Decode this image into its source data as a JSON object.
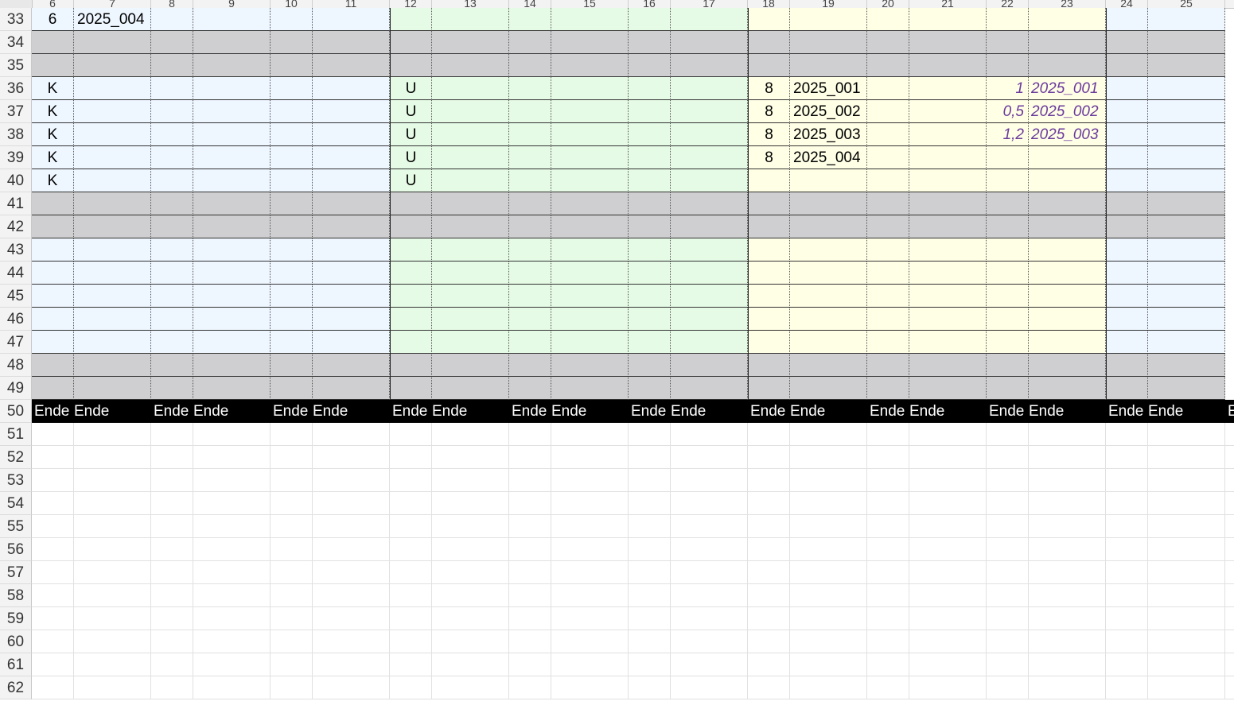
{
  "column_headers": [
    "6",
    "7",
    "8",
    "9",
    "10",
    "11",
    "12",
    "13",
    "14",
    "15",
    "16",
    "17",
    "18",
    "19",
    "20",
    "21",
    "22",
    "23",
    "24",
    "25"
  ],
  "colors": {
    "blue_band": "#eef6ff",
    "green_band": "#e6fbe6",
    "yellow_band": "#ffffe6",
    "gray_row": "#cfcfd1",
    "end_row": "#000000",
    "italic_values": "#6a3a9c"
  },
  "rows": [
    {
      "num": "33",
      "type": "data",
      "cells": {
        "0": "6",
        "1": "2025_004"
      }
    },
    {
      "num": "34",
      "type": "gray",
      "cells": {}
    },
    {
      "num": "35",
      "type": "gray",
      "cells": {}
    },
    {
      "num": "36",
      "type": "data",
      "cells": {
        "0": "K",
        "6": "U",
        "12": "8",
        "13": "2025_001",
        "16": "1",
        "17": "2025_001"
      }
    },
    {
      "num": "37",
      "type": "data",
      "cells": {
        "0": "K",
        "6": "U",
        "12": "8",
        "13": "2025_002",
        "16": "0,5",
        "17": "2025_002"
      }
    },
    {
      "num": "38",
      "type": "data",
      "cells": {
        "0": "K",
        "6": "U",
        "12": "8",
        "13": "2025_003",
        "16": "1,2",
        "17": "2025_003"
      }
    },
    {
      "num": "39",
      "type": "data",
      "cells": {
        "0": "K",
        "6": "U",
        "12": "8",
        "13": "2025_004"
      }
    },
    {
      "num": "40",
      "type": "data",
      "cells": {
        "0": "K",
        "6": "U"
      }
    },
    {
      "num": "41",
      "type": "gray",
      "cells": {}
    },
    {
      "num": "42",
      "type": "gray",
      "cells": {}
    },
    {
      "num": "43",
      "type": "data",
      "cells": {}
    },
    {
      "num": "44",
      "type": "data",
      "cells": {}
    },
    {
      "num": "45",
      "type": "data",
      "cells": {}
    },
    {
      "num": "46",
      "type": "data",
      "cells": {}
    },
    {
      "num": "47",
      "type": "data",
      "cells": {}
    },
    {
      "num": "48",
      "type": "gray",
      "cells": {}
    },
    {
      "num": "49",
      "type": "gray",
      "cells": {}
    },
    {
      "num": "50",
      "type": "end",
      "cells": {
        "0": "Ende",
        "1": "Ende",
        "3": "Ende",
        "4": "Ende",
        "6": "Ende",
        "7": "Ende",
        "9": "Ende",
        "10": "Ende",
        "12": "Ende",
        "13": "Ende",
        "15": "Ende",
        "16": "Ende",
        "18": "Ende",
        "19": "Ende",
        "21": "Ende",
        "22": "Ende",
        "24": "Ende",
        "25": "Ende",
        "27": "Ende",
        "28": "Ende",
        "30": "E"
      }
    },
    {
      "num": "51",
      "type": "empty",
      "cells": {}
    },
    {
      "num": "52",
      "type": "empty",
      "cells": {}
    },
    {
      "num": "53",
      "type": "empty",
      "cells": {}
    },
    {
      "num": "54",
      "type": "empty",
      "cells": {}
    },
    {
      "num": "55",
      "type": "empty",
      "cells": {}
    },
    {
      "num": "56",
      "type": "empty",
      "cells": {}
    },
    {
      "num": "57",
      "type": "empty",
      "cells": {}
    },
    {
      "num": "58",
      "type": "empty",
      "cells": {}
    },
    {
      "num": "59",
      "type": "empty",
      "cells": {}
    },
    {
      "num": "60",
      "type": "empty",
      "cells": {}
    },
    {
      "num": "61",
      "type": "empty",
      "cells": {}
    },
    {
      "num": "62",
      "type": "empty",
      "cells": {}
    }
  ]
}
